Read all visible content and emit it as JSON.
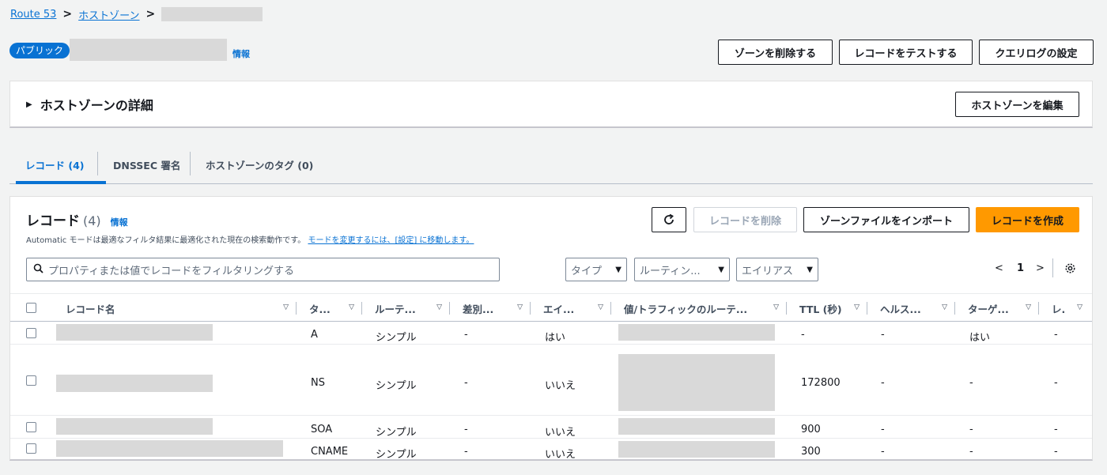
{
  "breadcrumb": {
    "root": "Route 53",
    "zones": "ホストゾーン",
    "sep": ">"
  },
  "header": {
    "badge": "パブリック",
    "info": "情報",
    "buttons": {
      "delete_zone": "ゾーンを削除する",
      "test_record": "レコードをテストする",
      "query_log": "クエリログの設定"
    }
  },
  "details": {
    "title": "ホストゾーンの詳細",
    "edit": "ホストゾーンを編集"
  },
  "tabs": [
    {
      "label": "レコード (4)"
    },
    {
      "label": "DNSSEC 署名"
    },
    {
      "label": "ホストゾーンのタグ (0)"
    }
  ],
  "records": {
    "title": "レコード",
    "count": "(4)",
    "info": "情報",
    "refresh_icon": "refresh-icon",
    "delete": "レコードを削除",
    "import": "ゾーンファイルをインポート",
    "create": "レコードを作成",
    "desc": "Automatic モードは最適なフィルタ結果に最適化された現在の検索動作です。",
    "desc_link": "モードを変更するには、[設定] に移動します。",
    "search_placeholder": "プロパティまたは値でレコードをフィルタリングする",
    "filters": {
      "type": "タイプ",
      "routing": "ルーティン...",
      "alias": "エイリアス"
    },
    "page": "1",
    "columns": [
      "レコード名",
      "タ...",
      "ルーテ...",
      "差別...",
      "エイ...",
      "値/トラフィックのルーテ...",
      "TTL (秒)",
      "ヘルス...",
      "ターゲ...",
      "レ."
    ],
    "rows": [
      {
        "type": "A",
        "routing": "シンプル",
        "diff": "-",
        "alias": "はい",
        "ttl": "-",
        "health": "-",
        "target": "はい",
        "rec": "-"
      },
      {
        "type": "NS",
        "routing": "シンプル",
        "diff": "-",
        "alias": "いいえ",
        "ttl": "172800",
        "health": "-",
        "target": "-",
        "rec": "-"
      },
      {
        "type": "SOA",
        "routing": "シンプル",
        "diff": "-",
        "alias": "いいえ",
        "ttl": "900",
        "health": "-",
        "target": "-",
        "rec": "-"
      },
      {
        "type": "CNAME",
        "routing": "シンプル",
        "diff": "-",
        "alias": "いいえ",
        "ttl": "300",
        "health": "-",
        "target": "-",
        "rec": "-"
      }
    ]
  },
  "colors": {
    "accent": "#0972d3",
    "primary": "#ff9900"
  }
}
